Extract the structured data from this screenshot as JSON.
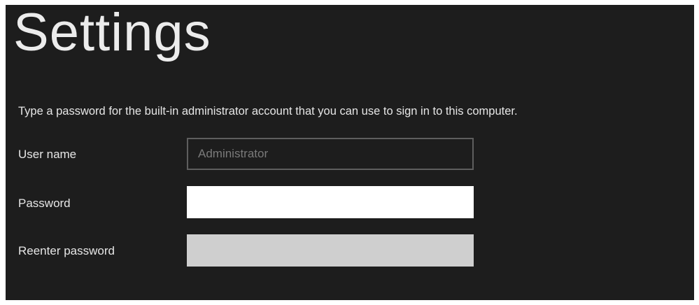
{
  "header": {
    "title": "Settings"
  },
  "form": {
    "description": "Type a password for the built-in administrator account that you can use to sign in to this computer.",
    "username": {
      "label": "User name",
      "value": "Administrator"
    },
    "password": {
      "label": "Password",
      "value": ""
    },
    "reenter_password": {
      "label": "Reenter password",
      "value": ""
    }
  },
  "colors": {
    "background": "#1d1d1d",
    "text": "#e6e6e6",
    "disabled_border": "#5e5e5e",
    "active_field": "#ffffff",
    "inactive_field": "#cfcfcf"
  }
}
